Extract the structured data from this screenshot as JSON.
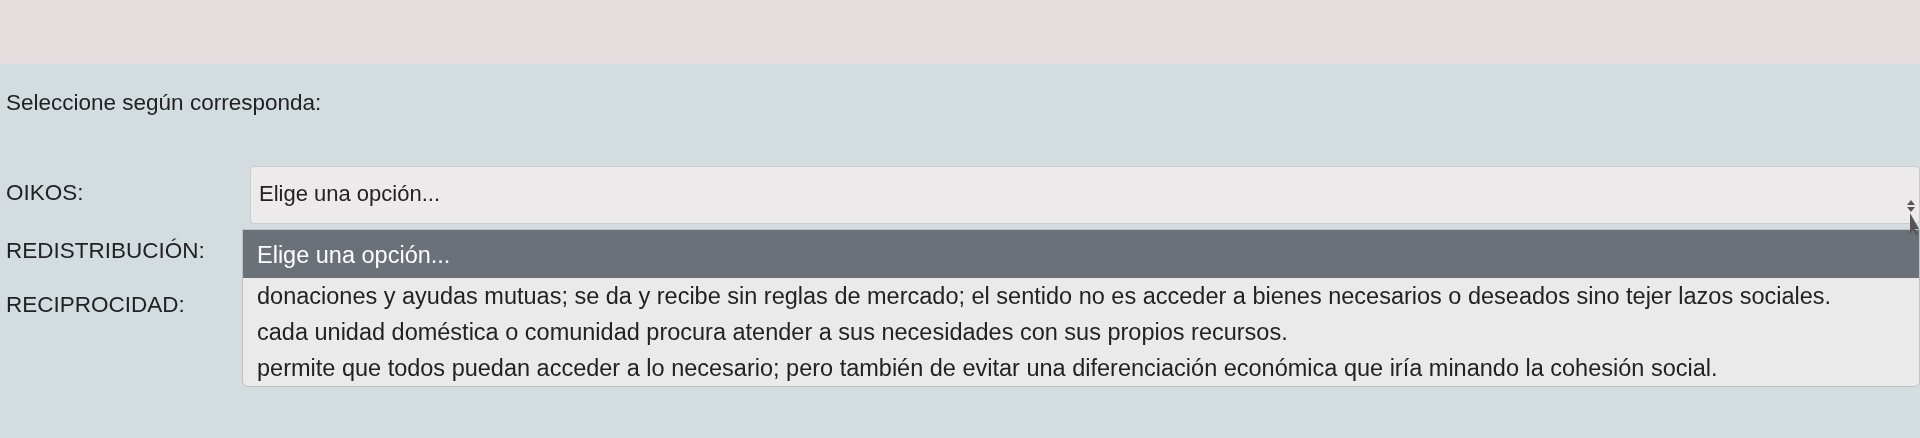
{
  "instruction": "Seleccione según corresponda:",
  "questions": [
    {
      "label": "OIKOS:",
      "value": "Elige una opción..."
    },
    {
      "label": "REDISTRIBUCIÓN:",
      "expanded": true
    },
    {
      "label": "RECIPROCIDAD:"
    }
  ],
  "dropdown": {
    "options": [
      {
        "text": "Elige una opción...",
        "selected": true
      },
      {
        "text": "donaciones y ayudas mutuas; se da y recibe sin reglas de mercado; el sentido no es acceder a bienes necesarios o deseados sino tejer lazos sociales.",
        "selected": false
      },
      {
        "text": "cada unidad doméstica o comunidad procura atender a sus necesidades con sus propios recursos.",
        "selected": false
      },
      {
        "text": "permite que todos puedan acceder a lo necesario; pero también de evitar una diferenciación económica que iría minando la cohesión social.",
        "selected": false
      }
    ]
  }
}
